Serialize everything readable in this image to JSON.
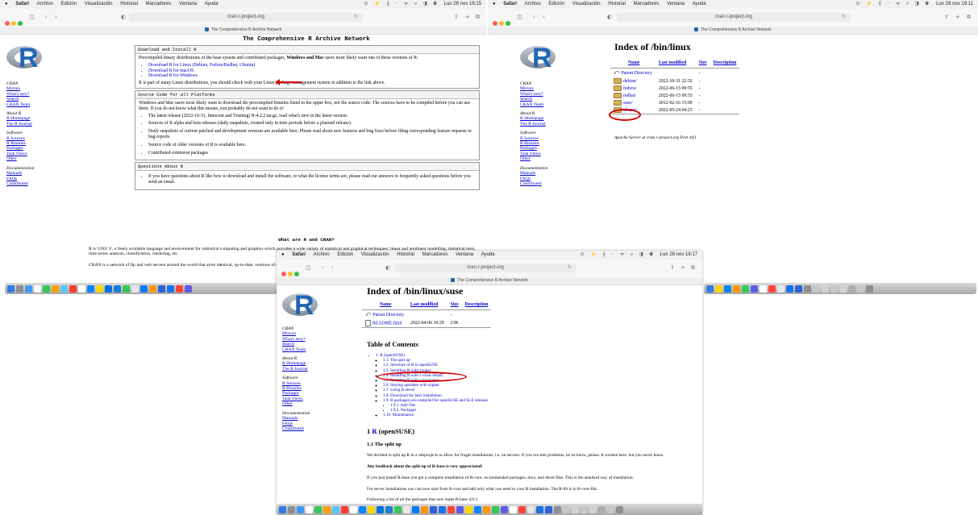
{
  "menubar": {
    "items": [
      "Safari",
      "Archivo",
      "Edición",
      "Visualización",
      "Historial",
      "Marcadores",
      "Ventana",
      "Ayuda"
    ],
    "status_icons": "⊙ ⚡ 𝄞 ⌁ ᯤ ⌕ ◨ ◉",
    "clock_left": "Lun 28 nov 19:15",
    "clock_right": "Lun 28 nov 19:11",
    "clock_center": "Lun 28 nov 19:17"
  },
  "browser": {
    "url": "cran.r-project.org",
    "tab_title": "The Comprehensive R Archive Network",
    "nav_back": "‹",
    "nav_forward": "›",
    "sidebar_toggle": "◫",
    "shield": "◐",
    "reload": "↻",
    "share": "⇪",
    "new_tab": "+",
    "tabs_overview": "⧉"
  },
  "sidebar": {
    "sections": [
      {
        "heading": "CRAN",
        "links": [
          "Mirrors",
          "What's new?",
          "Search",
          "CRAN Team"
        ]
      },
      {
        "heading": "About R",
        "links": [
          "R Homepage",
          "The R Journal"
        ]
      },
      {
        "heading": "Software",
        "links": [
          "R Sources",
          "R Binaries",
          "Packages",
          "Task Views",
          "Other"
        ]
      },
      {
        "heading": "Documentation",
        "links": [
          "Manuals",
          "FAQs",
          "Contributed"
        ]
      }
    ]
  },
  "left": {
    "site_title": "The Comprehensive R Archive Network",
    "download": {
      "heading": "Download and Install R",
      "intro_1": "Precompiled binary distributions of the base system and contributed packages, ",
      "intro_bold": "Windows and Mac",
      "intro_2": " users most likely want one of these versions of R:",
      "links": [
        {
          "text": "Download R for Linux",
          "extra": "(Debian, Fedora/Redhat, Ubuntu)"
        },
        {
          "text": "Download R for macOS",
          "extra": ""
        },
        {
          "text": "Download R for Windows",
          "extra": ""
        }
      ],
      "outro": "R is part of many Linux distributions, you should check with your Linux package management system in addition to the link above."
    },
    "source": {
      "heading": "Source Code for all Platforms",
      "intro": "Windows and Mac users most likely want to download the precompiled binaries listed in the upper box, not the source code. The sources have to be compiled before you can use them. If you do not know what this means, you probably do not want to do it!",
      "items": [
        "The latest release (2022-10-31, Innocent and Trusting) R-4.2.2.tar.gz, read what's new in the latest version.",
        "Sources of R alpha and beta releases (daily snapshots, created only in time periods before a planned release).",
        "Daily snapshots of current patched and development versions are available here. Please read about new features and bug fixes before filing corresponding feature requests or bug reports.",
        "Source code of older versions of R is available here.",
        "Contributed extension packages"
      ]
    },
    "questions": {
      "heading": "Questions About R",
      "text": "If you have questions about R like how to download and install the software, or what the license terms are, please read our answers to frequently asked questions before you send an email."
    },
    "what_heading": "What are R and CRAN?",
    "what_p1": "R is 'GNU S', a freely available language and environment for statistical computing and graphics which provides a wide variety of statistical and graphical techniques: linear and nonlinear modelling, statistical tests, time series analysis, classification, clustering, etc.",
    "what_p2": "CRAN is a network of ftp and web servers around the world that store identical, up-to-date, versions of code and documentation for R. Please use the CRAN mirror nearest to you to minimize network load."
  },
  "right": {
    "title": "Index of /bin/linux",
    "columns": [
      "Name",
      "Last modified",
      "Size",
      "Description"
    ],
    "parent": "Parent Directory",
    "parent_size": "-",
    "rows": [
      {
        "name": "debian/",
        "modified": "2022-10-31 22:32",
        "size": "-"
      },
      {
        "name": "fedora/",
        "modified": "2022-06-15 09:55",
        "size": "-"
      },
      {
        "name": "redhat/",
        "modified": "2022-06-15 09:55",
        "size": "-"
      },
      {
        "name": "suse/",
        "modified": "2012-02-16 15:09",
        "size": "-"
      },
      {
        "name": "ubuntu/",
        "modified": "2022-05-24 04:25",
        "size": "-"
      }
    ],
    "footer": "Apache Server at cran.r-project.org Port 443"
  },
  "center": {
    "title": "Index of /bin/linux/suse",
    "columns": [
      "Name",
      "Last modified",
      "Size",
      "Description"
    ],
    "parent": "Parent Directory",
    "parent_size": "-",
    "readme": {
      "name": "README.html",
      "modified": "2022-04-06 10:29",
      "size": "23K"
    },
    "toc_title": "Table of Contents",
    "toc_root": "1. R (openSUSE)",
    "toc_items": [
      "1.1. The split up",
      "1.2. Structure of R in openSUSE",
      "1.3. Installing R with zypper",
      "1.4. Installing R with 1-click-install",
      "1.5. Installing R with a local repo",
      "1.6. Staying uptodate with zypper",
      "1.7. Using R-devel",
      "1.8. Download for later installation",
      "1.9. R packages pre-compiled for openSUSE and SLE releases"
    ],
    "toc_sub": [
      "1.9.1. Add Ons",
      "1.9.2. Packages"
    ],
    "toc_last": "1.10. Maintenance",
    "h1_num": "1",
    "h1_r": "R",
    "h1_rest": "(openSUSE)",
    "h2": "1.1 The split up",
    "p1": "We decided to split up R in a subprojects to allow for frugal installations, i.e. on servers. If you run into problems, let us know, please. It worked here, but you never know.",
    "p2": "Any feedback about the split-up of R-base is very appreciated!",
    "p3": "If you just install R-base you get a complete installation of R-core, recommended packages, docs, and devel files. This is the standard way of installation.",
    "p4": "For server installations you can now start from R-core and add only what you need to your R installation. The R-lib is in R-core-libs.",
    "p5": "Following a list of all the packages that now make R-base 4.0.3"
  }
}
